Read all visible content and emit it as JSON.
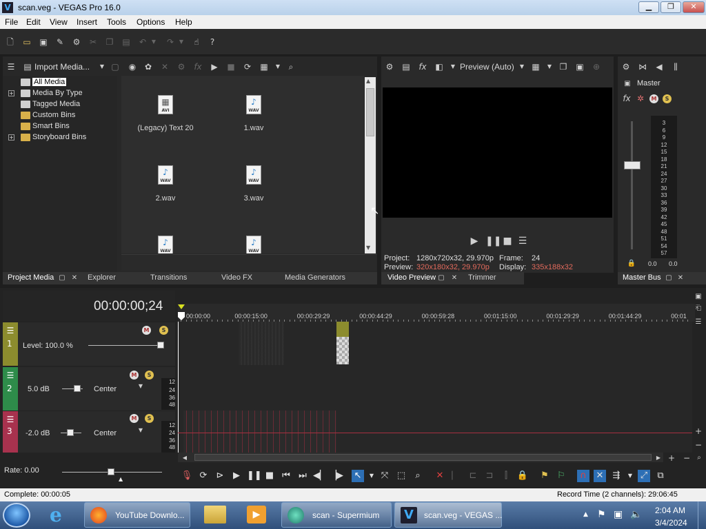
{
  "window": {
    "title": "scan.veg - VEGAS Pro 16.0",
    "minimize": "▁",
    "maximize": "❐",
    "close": "✕"
  },
  "menu": [
    "File",
    "Edit",
    "View",
    "Insert",
    "Tools",
    "Options",
    "Help"
  ],
  "project_media": {
    "import_label": "Import Media...",
    "tree": [
      "All Media",
      "Media By Type",
      "Tagged Media",
      "Custom Bins",
      "Smart Bins",
      "Storyboard Bins"
    ],
    "items": [
      {
        "name": "(Legacy) Text 20",
        "ext": "AVI"
      },
      {
        "name": "1.wav",
        "ext": "WAV"
      },
      {
        "name": "2.wav",
        "ext": "WAV"
      },
      {
        "name": "3.wav",
        "ext": "WAV"
      },
      {
        "name": "",
        "ext": "WAV"
      },
      {
        "name": "",
        "ext": "WAV"
      }
    ]
  },
  "left_tabs": [
    "Project Media",
    "Explorer",
    "Transitions",
    "Video FX",
    "Media Generators"
  ],
  "preview": {
    "mode": "Preview (Auto)",
    "project_label": "Project:",
    "project_value": "1280x720x32, 29.970p",
    "frame_label": "Frame:",
    "frame_value": "24",
    "preview_label": "Preview:",
    "preview_value": "320x180x32, 29.970p",
    "display_label": "Display:",
    "display_value": "335x188x32",
    "tabs": [
      "Video Preview",
      "Trimmer"
    ]
  },
  "master": {
    "label": "Master",
    "meter_ticks": [
      "3",
      "6",
      "9",
      "12",
      "15",
      "18",
      "21",
      "24",
      "27",
      "30",
      "33",
      "36",
      "39",
      "42",
      "45",
      "48",
      "51",
      "54",
      "57"
    ],
    "left_value": "0.0",
    "right_value": "0.0",
    "tab": "Master Bus"
  },
  "timeline": {
    "timecode": "00:00:00;24",
    "ruler": [
      "00:00:00",
      "00:00:15:00",
      "00:00:29:29",
      "00:00:44:29",
      "00:00:59:28",
      "00:01:15:00",
      "00:01:29:29",
      "00:01:44:29",
      "00:01"
    ],
    "track1": {
      "num": "1",
      "level": "Level: 100.0 %"
    },
    "track2": {
      "num": "2",
      "db": "5.0 dB",
      "pan": "Center"
    },
    "track3": {
      "num": "3",
      "db": "-2.0 dB",
      "pan": "Center"
    },
    "db_scale": [
      "12",
      "24",
      "36",
      "48"
    ],
    "rate": "Rate: 0.00"
  },
  "status": {
    "left": "Complete: 00:00:05",
    "right": "Record Time (2 channels): 29:06:45"
  },
  "taskbar": {
    "items": [
      "YouTube Downlo...",
      "scan - Supermium",
      "scan.veg - VEGAS ..."
    ],
    "time": "2:04 AM",
    "date": "3/4/2024"
  },
  "colors": {
    "track1": "#8c8c2e",
    "track2": "#2e8c4a",
    "track3": "#a8324e",
    "accent": "#3fa9f5"
  }
}
